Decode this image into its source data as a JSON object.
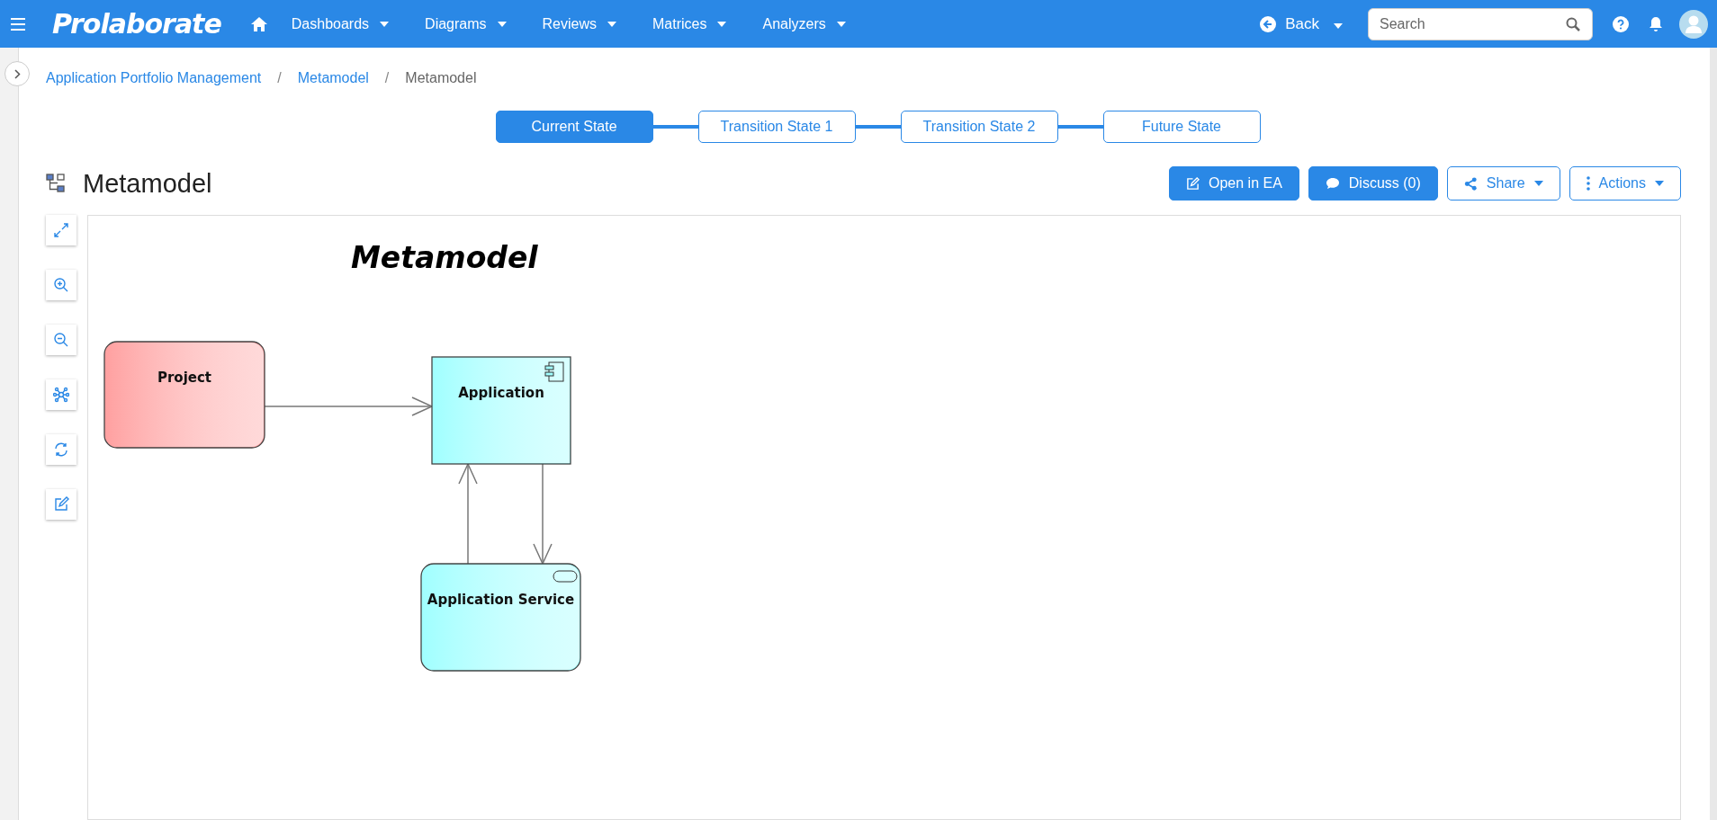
{
  "topbar": {
    "logo": "Prolaborate",
    "menus": [
      {
        "label": "Dashboards"
      },
      {
        "label": "Diagrams"
      },
      {
        "label": "Reviews"
      },
      {
        "label": "Matrices"
      },
      {
        "label": "Analyzers"
      }
    ],
    "back": "Back",
    "search": {
      "placeholder": "Search"
    }
  },
  "breadcrumb": {
    "separator": "/",
    "items": [
      {
        "label": "Application Portfolio Management",
        "link": true
      },
      {
        "label": "Metamodel",
        "link": true
      },
      {
        "label": "Metamodel",
        "link": false
      }
    ]
  },
  "states": [
    {
      "label": "Current State",
      "selected": true
    },
    {
      "label": "Transition State 1",
      "selected": false
    },
    {
      "label": "Transition State 2",
      "selected": false
    },
    {
      "label": "Future State",
      "selected": false
    }
  ],
  "page_title": "Metamodel",
  "actions": [
    {
      "label": "Open in EA",
      "kind": "edit"
    },
    {
      "label": "Discuss (0)",
      "kind": "comment"
    },
    {
      "label": "Share",
      "kind": "share"
    },
    {
      "label": "Actions",
      "kind": "more"
    }
  ],
  "tools": [
    {
      "kind": "fit"
    },
    {
      "kind": "zoom-in"
    },
    {
      "kind": "zoom-out"
    },
    {
      "kind": "network"
    },
    {
      "kind": "refresh"
    },
    {
      "kind": "edit"
    }
  ],
  "diagram": {
    "title": "Metamodel",
    "nodes": [
      {
        "label": "Project",
        "kind": "plain",
        "color": "#ffa0a0"
      },
      {
        "label": "Application",
        "kind": "component",
        "color": "#a0ffff"
      },
      {
        "label": "Application Service",
        "kind": "service",
        "color": "#a0ffff"
      }
    ]
  }
}
